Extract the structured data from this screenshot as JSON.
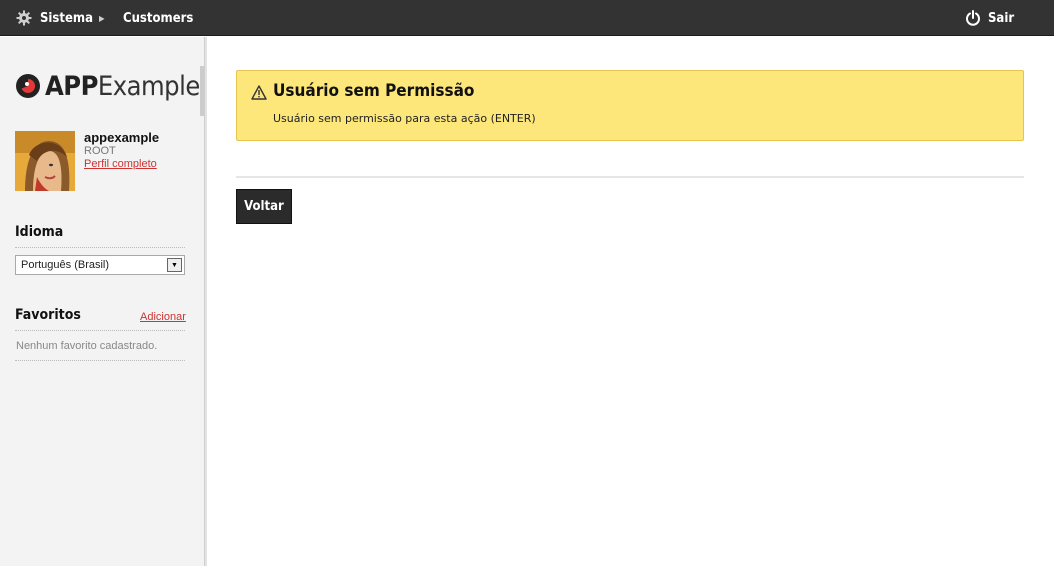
{
  "topbar": {
    "sistema_label": "Sistema",
    "sistema_icon": "gear-icon",
    "customers_label": "Customers",
    "sair_label": "Sair",
    "sair_icon": "power-icon"
  },
  "sidebar": {
    "logo_app": "APP",
    "logo_example": "Example",
    "user": {
      "name": "appexample",
      "role": "ROOT",
      "profile_link": "Perfil completo"
    },
    "idioma": {
      "title": "Idioma",
      "selected": "Português (Brasil)"
    },
    "favoritos": {
      "title": "Favoritos",
      "add_label": "Adicionar",
      "empty_text": "Nenhum favorito cadastrado."
    }
  },
  "main": {
    "alert": {
      "icon": "warning-icon",
      "title": "Usuário sem Permissão",
      "message": "Usuário sem permissão para esta ação (ENTER)",
      "background": "#fde77a"
    },
    "back_button": "Voltar"
  }
}
